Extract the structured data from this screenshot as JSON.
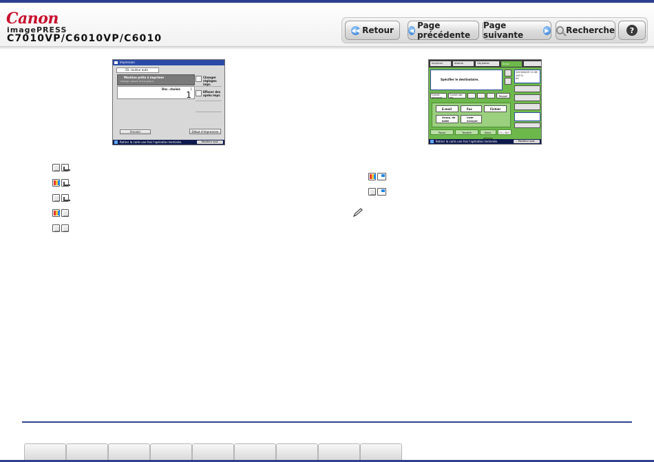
{
  "header": {
    "brand": "Canon",
    "product": "imagePRESS",
    "model": "C7010VP/C6010VP/C6010"
  },
  "nav": {
    "back": "Retour",
    "prev": "Page précédente",
    "next": "Page suivante",
    "search": "Recherche",
    "help": "?"
  },
  "screen1": {
    "title": "Impression",
    "source": "SS: couleur auto",
    "machine_ready": "Machine prête à imprimer",
    "settings_info": "Interlign. valeurs. R.Vrai Jusqu'à",
    "doc_label": "Doc. choisis",
    "doc_count": "1",
    "doc_total": "1",
    "change_btn": "Changer réglages impr.",
    "delete_btn": "Effacer des après impr.",
    "cancel_btn": "Annuler",
    "start_btn": "Début d'impression",
    "status": "Retirer la carte une fois l'opération terminée.",
    "monitor": "Moniteur syst."
  },
  "screen2": {
    "tabs": [
      "Imprimer",
      "Attente",
      "Obj boîtes",
      "Envoi"
    ],
    "specify": "Spécifier le destinataire.",
    "date": "2013/06/29 11:58",
    "zoom": "100 %",
    "paper": "A4",
    "address_book": "Carnet adresses",
    "address_book2": "Carnet adr. rés.",
    "recall": "Rappel",
    "email": "E-mail",
    "fax": "Fax",
    "file": "Fichier",
    "group": "Group. de boîte",
    "specify_btn": "Liste envoyer",
    "pause": "Pause",
    "tone": "Tonalité",
    "new_addr": "Nouv. adresse",
    "cc": "CC / BCC",
    "status": "Retirer la carte une fois l'opération terminée.",
    "monitor": "Moniteur syst."
  },
  "colors": {
    "accent": "#2e3f8f",
    "brand_red": "#c8102e",
    "screen_green": "#6db84b"
  }
}
